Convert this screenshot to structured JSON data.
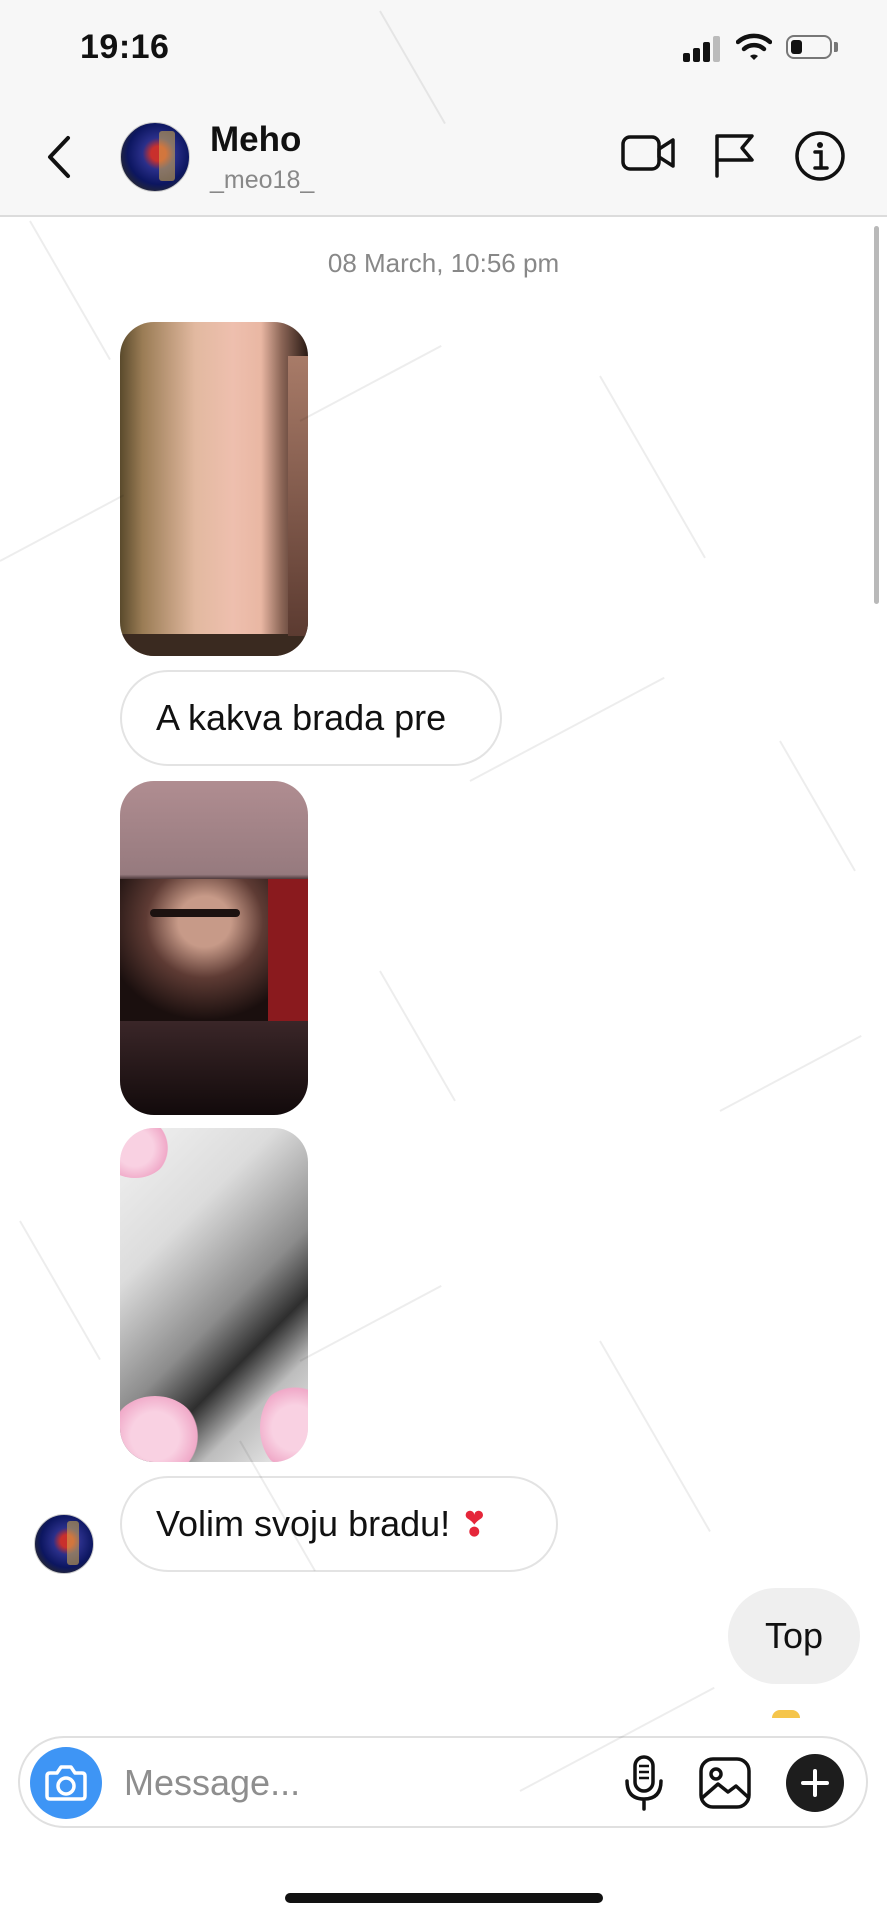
{
  "status_bar": {
    "time": "19:16",
    "icons": [
      "signal-icon",
      "wifi-icon",
      "battery-icon"
    ]
  },
  "header": {
    "back_icon": "chevron-left-icon",
    "contact_name": "Meho",
    "contact_username": "_meo18_",
    "actions": [
      "video-camera-icon",
      "flag-icon",
      "info-icon"
    ]
  },
  "chat": {
    "date_label": "08 March, 10:56 pm",
    "messages": [
      {
        "type": "photo",
        "from": "contact"
      },
      {
        "type": "text",
        "from": "contact",
        "text": "A kakva brada pre"
      },
      {
        "type": "photo",
        "from": "contact"
      },
      {
        "type": "photo",
        "from": "contact"
      },
      {
        "type": "text",
        "from": "contact",
        "text": "Volim svoju bradu!",
        "emoji": "❣"
      },
      {
        "type": "text",
        "from": "me",
        "text": "Top"
      }
    ]
  },
  "composer": {
    "placeholder": "Message...",
    "icons": [
      "camera-icon",
      "microphone-icon",
      "gallery-icon",
      "plus-icon"
    ]
  },
  "colors": {
    "accent_blue": "#3e95f5",
    "header_bg": "#f7f7f7",
    "bubble_border": "#e3e3e3",
    "sent_bubble": "#efefef"
  }
}
